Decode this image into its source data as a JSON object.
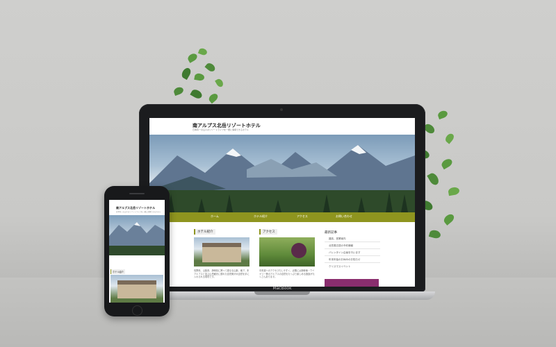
{
  "laptop": {
    "brand": "MacBook",
    "site": {
      "title": "南アルプス北岳リゾートホテル",
      "tagline": "日本有一の山人のリゾートライフを一層に満喫できるホテル",
      "nav": [
        "ホーム",
        "ホテル紹介",
        "アクセス",
        "お問い合わせ"
      ],
      "sections": [
        {
          "title": "ホテル紹介",
          "text": "長野県、山梨県、静岡県に跨って連なる山脈、南ア、本アルプスと並ぶ山岳観光に優れた自然美が大自然を手に入れられる環境です。"
        },
        {
          "title": "アクセス",
          "text": "中央道へのアクセスもしやすく、近隣には新幹線・ワイナリー等のアルプスの自然をたっぷり楽しめる施設がたくさんあります。"
        }
      ],
      "sidebar": {
        "title": "最新記事",
        "items": [
          "雑誌、営業案内",
          "北岳周辺週の予約情報",
          "バレンタイン企画を行います",
          "年末年始のお休みのお知らせ",
          "クリスマスイベント"
        ]
      }
    }
  },
  "phone": {
    "title": "南アルプス北岳リゾートホテル",
    "tagline": "日本有一の山人のリゾートライフを一層に満喫できるホテル",
    "section": "ホテル紹介"
  },
  "colors": {
    "nav_accent": "#8f951f",
    "sidebar_banner": "#8a2e6e",
    "leaf": "#4e8a3a"
  }
}
